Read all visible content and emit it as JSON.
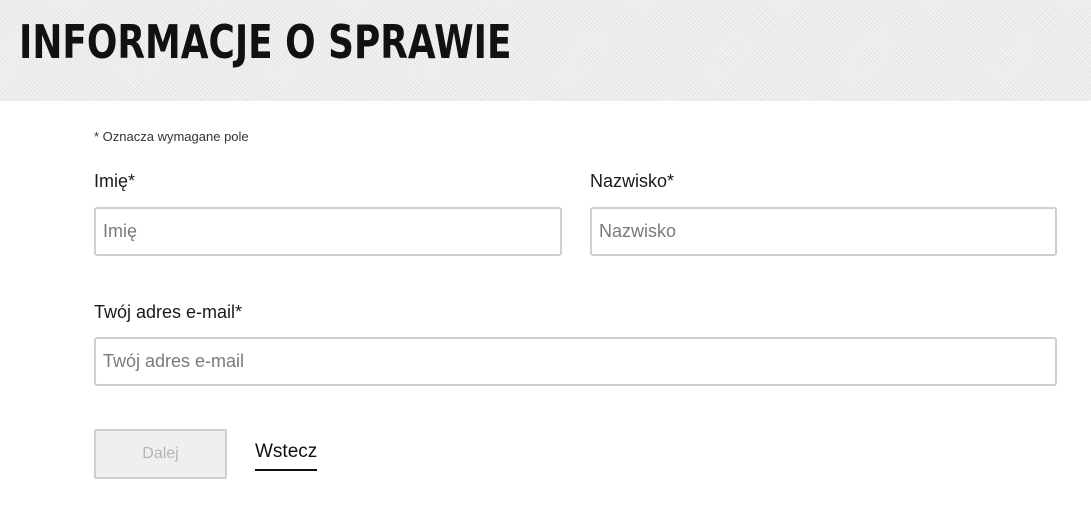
{
  "header": {
    "title": "INFORMACJE O SPRAWIE"
  },
  "form": {
    "required_note": "* Oznacza wymagane pole",
    "first_name": {
      "label": "Imię*",
      "placeholder": "Imię",
      "value": ""
    },
    "last_name": {
      "label": "Nazwisko*",
      "placeholder": "Nazwisko",
      "value": ""
    },
    "email": {
      "label": "Twój adres e-mail*",
      "placeholder": "Twój adres e-mail",
      "value": ""
    }
  },
  "actions": {
    "next_label": "Dalej",
    "next_disabled": true,
    "back_label": "Wstecz"
  },
  "colors": {
    "header_bg": "#ececec",
    "title": "#111111",
    "input_border": "#cfcfcf",
    "disabled_button_bg": "#efefef",
    "disabled_button_text": "#b5b5b5"
  }
}
